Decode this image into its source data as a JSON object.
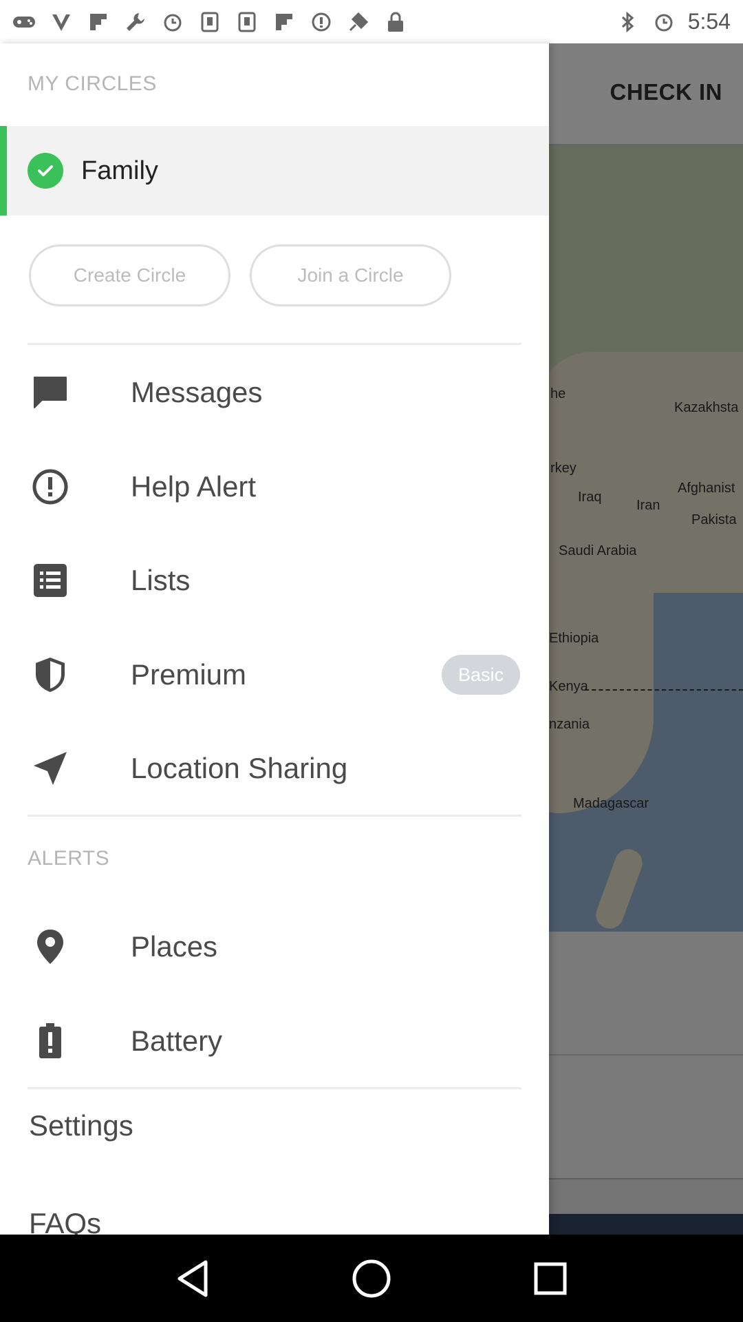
{
  "status_bar": {
    "time": "5:54",
    "left_icons": [
      "gamepad-icon",
      "vpn-icon",
      "flipboard-icon",
      "wrench-icon",
      "alarm-icon",
      "sim-icon",
      "sim-icon-2",
      "flipboard-icon-2",
      "info-icon",
      "fake-gps-icon",
      "lock-icon"
    ],
    "right_icons": [
      "bluetooth-icon",
      "alarm-icon"
    ]
  },
  "background_app": {
    "check_in_label": "CHECK IN",
    "map_labels": {
      "kazakhstan": "Kazakhsta",
      "turkey": "rkey",
      "iraq": "Iraq",
      "iran": "Iran",
      "afghanistan": "Afghanist",
      "pakistan": "Pakista",
      "saudi": "Saudi Arabia",
      "ethiopia": "Ethiopia",
      "kenya": "Kenya",
      "tanzania": "nzania",
      "madagascar": "Madagascar",
      "partial": "he"
    }
  },
  "drawer": {
    "my_circles_header": "MY CIRCLES",
    "active_circle": "Family",
    "create_circle_label": "Create Circle",
    "join_circle_label": "Join a Circle",
    "menu_items": [
      {
        "label": "Messages",
        "icon": "chat-icon"
      },
      {
        "label": "Help Alert",
        "icon": "alert-icon"
      },
      {
        "label": "Lists",
        "icon": "list-icon"
      },
      {
        "label": "Premium",
        "icon": "shield-icon",
        "badge": "Basic"
      },
      {
        "label": "Location Sharing",
        "icon": "navigation-arrow-icon"
      }
    ],
    "alerts_header": "ALERTS",
    "alert_items": [
      {
        "label": "Places",
        "icon": "map-pin-icon"
      },
      {
        "label": "Battery",
        "icon": "battery-alert-icon"
      }
    ],
    "settings_label": "Settings",
    "faqs_label": "FAQs"
  },
  "colors": {
    "accent_green": "#3ac15a",
    "text_primary": "#4a4a4a",
    "muted": "#b5b5b5"
  }
}
